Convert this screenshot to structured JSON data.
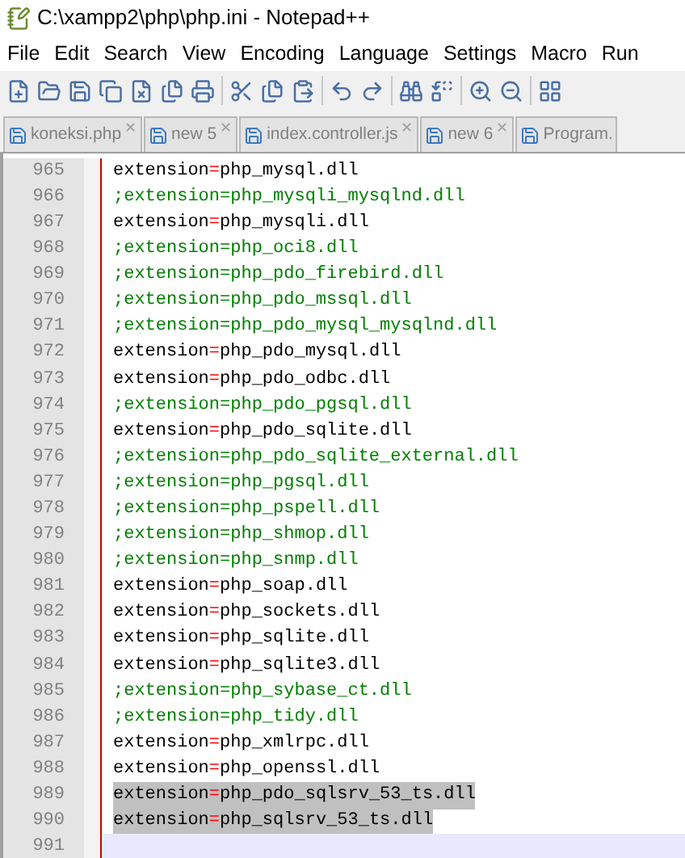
{
  "window": {
    "title": "C:\\xampp2\\php\\php.ini - Notepad++"
  },
  "menu": [
    "File",
    "Edit",
    "Search",
    "View",
    "Encoding",
    "Language",
    "Settings",
    "Macro",
    "Run"
  ],
  "tabs": [
    {
      "label": "koneksi.php",
      "close": "✕"
    },
    {
      "label": "new 5",
      "close": "✕"
    },
    {
      "label": "index.controller.js",
      "close": "✕"
    },
    {
      "label": "new 6",
      "close": "✕"
    },
    {
      "label": "Program."
    }
  ],
  "lines": [
    {
      "number": "965",
      "kind": "setting",
      "text": "extension=php_mysql.dll",
      "selected": false,
      "current": false
    },
    {
      "number": "966",
      "kind": "comment",
      "text": ";extension=php_mysqli_mysqlnd.dll",
      "selected": false,
      "current": false
    },
    {
      "number": "967",
      "kind": "setting",
      "text": "extension=php_mysqli.dll",
      "selected": false,
      "current": false
    },
    {
      "number": "968",
      "kind": "comment",
      "text": ";extension=php_oci8.dll",
      "selected": false,
      "current": false
    },
    {
      "number": "969",
      "kind": "comment",
      "text": ";extension=php_pdo_firebird.dll",
      "selected": false,
      "current": false
    },
    {
      "number": "970",
      "kind": "comment",
      "text": ";extension=php_pdo_mssql.dll",
      "selected": false,
      "current": false
    },
    {
      "number": "971",
      "kind": "comment",
      "text": ";extension=php_pdo_mysql_mysqlnd.dll",
      "selected": false,
      "current": false
    },
    {
      "number": "972",
      "kind": "setting",
      "text": "extension=php_pdo_mysql.dll",
      "selected": false,
      "current": false
    },
    {
      "number": "973",
      "kind": "setting",
      "text": "extension=php_pdo_odbc.dll",
      "selected": false,
      "current": false
    },
    {
      "number": "974",
      "kind": "comment",
      "text": ";extension=php_pdo_pgsql.dll",
      "selected": false,
      "current": false
    },
    {
      "number": "975",
      "kind": "setting",
      "text": "extension=php_pdo_sqlite.dll",
      "selected": false,
      "current": false
    },
    {
      "number": "976",
      "kind": "comment",
      "text": ";extension=php_pdo_sqlite_external.dll",
      "selected": false,
      "current": false
    },
    {
      "number": "977",
      "kind": "comment",
      "text": ";extension=php_pgsql.dll",
      "selected": false,
      "current": false
    },
    {
      "number": "978",
      "kind": "comment",
      "text": ";extension=php_pspell.dll",
      "selected": false,
      "current": false
    },
    {
      "number": "979",
      "kind": "comment",
      "text": ";extension=php_shmop.dll",
      "selected": false,
      "current": false
    },
    {
      "number": "980",
      "kind": "comment",
      "text": ";extension=php_snmp.dll",
      "selected": false,
      "current": false
    },
    {
      "number": "981",
      "kind": "setting",
      "text": "extension=php_soap.dll",
      "selected": false,
      "current": false
    },
    {
      "number": "982",
      "kind": "setting",
      "text": "extension=php_sockets.dll",
      "selected": false,
      "current": false
    },
    {
      "number": "983",
      "kind": "setting",
      "text": "extension=php_sqlite.dll",
      "selected": false,
      "current": false
    },
    {
      "number": "984",
      "kind": "setting",
      "text": "extension=php_sqlite3.dll",
      "selected": false,
      "current": false
    },
    {
      "number": "985",
      "kind": "comment",
      "text": ";extension=php_sybase_ct.dll",
      "selected": false,
      "current": false
    },
    {
      "number": "986",
      "kind": "comment",
      "text": ";extension=php_tidy.dll",
      "selected": false,
      "current": false
    },
    {
      "number": "987",
      "kind": "setting",
      "text": "extension=php_xmlrpc.dll",
      "selected": false,
      "current": false
    },
    {
      "number": "988",
      "kind": "setting",
      "text": "extension=php_openssl.dll",
      "selected": false,
      "current": false
    },
    {
      "number": "989",
      "kind": "setting",
      "text": "extension=php_pdo_sqlsrv_53_ts.dll",
      "selected": true,
      "current": false
    },
    {
      "number": "990",
      "kind": "setting",
      "text": "extension=php_sqlsrv_53_ts.dll",
      "selected": true,
      "current": false
    },
    {
      "number": "991",
      "kind": "blank",
      "selected": false,
      "current": true
    }
  ]
}
